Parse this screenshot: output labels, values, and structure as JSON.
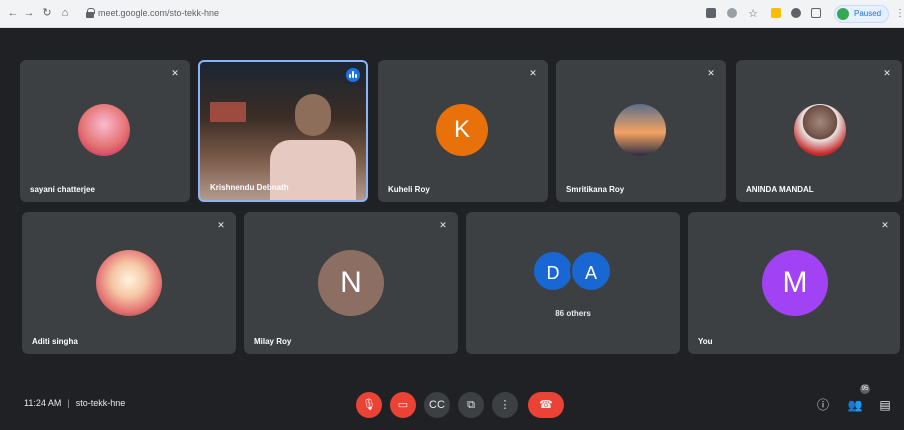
{
  "browser": {
    "url": "meet.google.com/sto-tekk-hne",
    "paused_label": "Paused"
  },
  "tiles": [
    {
      "name": "sayani chatterjee"
    },
    {
      "name": "Krishnendu Debnath"
    },
    {
      "name": "Kuheli Roy",
      "initial": "K"
    },
    {
      "name": "Smritikana Roy"
    },
    {
      "name": "ANINDA MANDAL"
    },
    {
      "name": "Aditi singha"
    },
    {
      "name": "Milay Roy",
      "initial": "N"
    },
    {
      "initials": [
        "D",
        "A"
      ],
      "others": "86 others"
    },
    {
      "name": "You",
      "initial": "M"
    }
  ],
  "bottom_bar": {
    "time": "11:24 AM",
    "meeting_code": "sto-tekk-hne",
    "participants_count": "95"
  },
  "colors": {
    "background": "#202124",
    "tile": "#3c4043",
    "red": "#ea4335",
    "blue_highlight": "#8ab4f8",
    "avatar_k": "#e8710a",
    "avatar_n": "#8d6e63",
    "avatar_m": "#a142f4",
    "avatar_d": "#1967d2",
    "avatar_a": "#1967d2"
  },
  "icons": {
    "mic_off": "mic-off-icon",
    "cam_off": "cam-off-icon",
    "captions": "captions-icon",
    "present": "present-icon",
    "more": "more-options-icon",
    "leave": "leave-call-icon",
    "info": "info-icon",
    "people": "people-icon",
    "chat": "chat-icon"
  }
}
